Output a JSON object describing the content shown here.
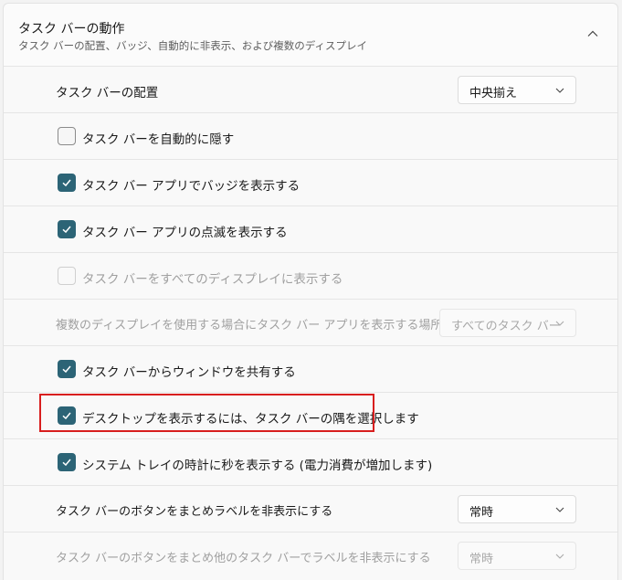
{
  "header": {
    "title": "タスク バーの動作",
    "subtitle": "タスク バーの配置、バッジ、自動的に非表示、および複数のディスプレイ"
  },
  "rows": {
    "alignment": {
      "label": "タスク バーの配置",
      "value": "中央揃え"
    },
    "auto_hide": {
      "label": "タスク バーを自動的に隠す",
      "checked": false
    },
    "badges": {
      "label": "タスク バー アプリでバッジを表示する",
      "checked": true
    },
    "flashing": {
      "label": "タスク バー アプリの点滅を表示する",
      "checked": true
    },
    "all_displays": {
      "label": "タスク バーをすべてのディスプレイに表示する",
      "checked": false,
      "disabled": true
    },
    "multi_display_location": {
      "label": "複数のディスプレイを使用する場合にタスク バー アプリを表示する場所",
      "value": "すべてのタスク バー",
      "disabled": true
    },
    "share_window": {
      "label": "タスク バーからウィンドウを共有する",
      "checked": true
    },
    "show_desktop": {
      "label": "デスクトップを表示するには、タスク バーの隅を選択します",
      "checked": true
    },
    "seconds_clock": {
      "label": "システム トレイの時計に秒を表示する (電力消費が増加します)",
      "checked": true
    },
    "combine_buttons": {
      "label": "タスク バーのボタンをまとめラベルを非表示にする",
      "value": "常時"
    },
    "combine_other": {
      "label": "タスク バーのボタンをまとめ他のタスク バーでラベルを非表示にする",
      "value": "常時",
      "disabled": true
    }
  },
  "colors": {
    "accent": "#2c6476",
    "highlight": "#d81e1e"
  }
}
